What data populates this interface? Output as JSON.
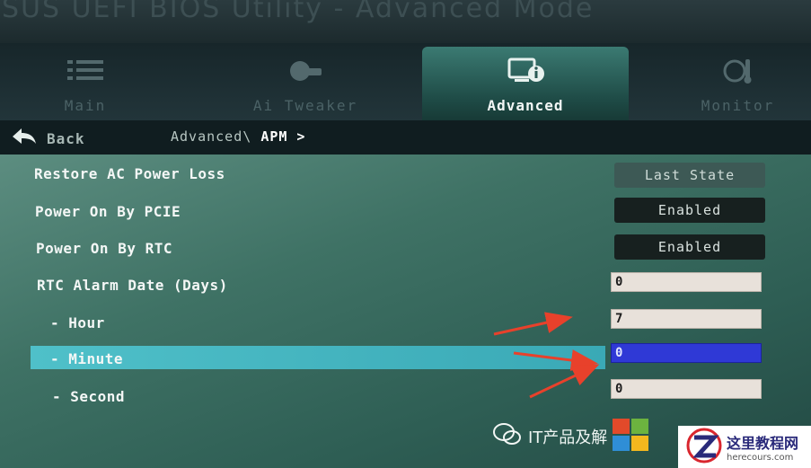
{
  "window": {
    "title": "UEFI BIOS Utility - Advanced Mode",
    "brand_fragment": "SUS"
  },
  "tabs": [
    {
      "label": "Main",
      "icon": "list-icon"
    },
    {
      "label": "Ai Tweaker",
      "icon": "tweaker-icon"
    },
    {
      "label": "Advanced",
      "icon": "advanced-icon",
      "active": true
    },
    {
      "label": "Monitor",
      "icon": "monitor-icon"
    }
  ],
  "nav": {
    "back_label": "Back",
    "breadcrumb_parent": "Advanced\\",
    "breadcrumb_current": "APM >"
  },
  "settings": [
    {
      "label": "Restore AC Power Loss",
      "value": "Last State"
    },
    {
      "label": "Power On By PCIE",
      "value": "Enabled"
    },
    {
      "label": "Power On By RTC",
      "value": "Enabled"
    },
    {
      "label": "RTC Alarm Date (Days)",
      "value": "0"
    },
    {
      "label": "- Hour",
      "value": "7"
    },
    {
      "label": "- Minute",
      "value": "0",
      "selected": true
    },
    {
      "label": "- Second",
      "value": "0"
    }
  ],
  "watermarks": {
    "wechat_text": "IT产品及解",
    "site_name": "这里教程网",
    "site_url": "herecours.com"
  },
  "colors": {
    "accent_tab": "#3b7a72",
    "selected_row": "#4fc0c9",
    "active_field": "#2f39d6",
    "arrow": "#e8412b"
  }
}
